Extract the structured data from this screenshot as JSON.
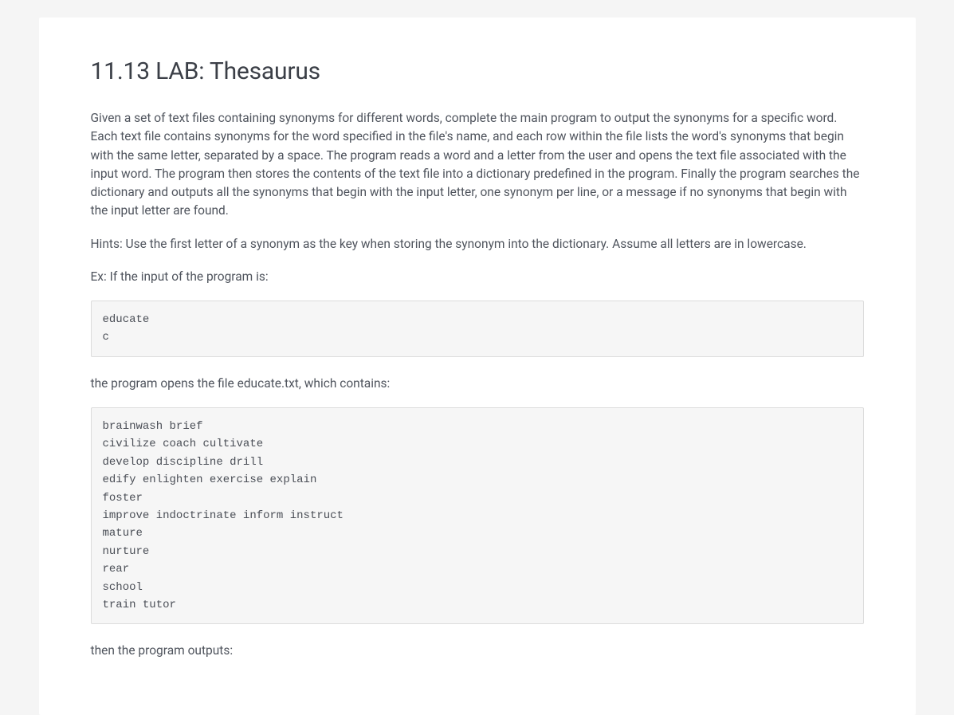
{
  "title": "11.13 LAB: Thesaurus",
  "paragraphs": {
    "intro": "Given a set of text files containing synonyms for different words, complete the main program to output the synonyms for a specific word. Each text file contains synonyms for the word specified in the file's name, and each row within the file lists the word's synonyms that begin with the same letter, separated by a space. The program reads a word and a letter from the user and opens the text file associated with the input word. The program then stores the contents of the text file into a dictionary predefined in the program. Finally the program searches the dictionary and outputs all the synonyms that begin with the input letter, one synonym per line, or a message if no synonyms that begin with the input letter are found.",
    "hints": "Hints: Use the first letter of a synonym as the key when storing the synonym into the dictionary. Assume all letters are in lowercase.",
    "example_lead": "Ex: If the input of the program is:",
    "file_lead": "the program opens the file educate.txt, which contains:",
    "output_lead": "then the program outputs:"
  },
  "code": {
    "input_example": "educate\nc",
    "file_contents": "brainwash brief\ncivilize coach cultivate\ndevelop discipline drill\nedify enlighten exercise explain\nfoster\nimprove indoctrinate inform instruct\nmature\nnurture\nrear\nschool\ntrain tutor"
  }
}
